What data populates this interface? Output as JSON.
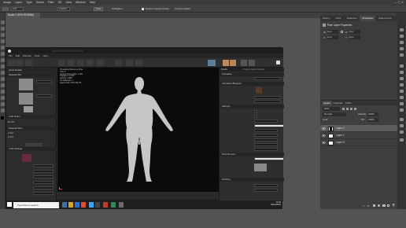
{
  "photoshop": {
    "menu": [
      "Image",
      "Layer",
      "Type",
      "Select",
      "Filter",
      "3D",
      "View",
      "Window",
      "Help"
    ],
    "options": {
      "antialias_label": "Anti",
      "value_label": "Feather",
      "style_label": "Normal",
      "select_mask_button": "Select and Mask...",
      "refine_label": "Refine Edge...",
      "clear_button": "Clear",
      "straighten_label": "Straighten",
      "delete_cropped_label": "Delete Cropped Pixels",
      "content_aware_label": "Content-Aware"
    },
    "document_tab": "Scale 1 50% RGB/8#)",
    "panel_tabs": [
      "History",
      "Color",
      "Swatches",
      "Properties",
      "Adjustments",
      "Libraries"
    ],
    "active_panel_tab": "Properties",
    "properties": {
      "title": "Pixel Layer Properties",
      "w_label": "W:",
      "w_value": "0 px",
      "h_label": "H:",
      "h_value": "0 px",
      "x_label": "X:",
      "x_value": "0 px",
      "y_label": "Y:",
      "y_value": "0 px"
    },
    "layers_panel": {
      "tabs": [
        "Layers",
        "Channels",
        "Paths"
      ],
      "kind_label": "Kind",
      "blend_mode": "Normal",
      "opacity_label": "Opacity:",
      "opacity_value": "100%",
      "lock_label": "Lock:",
      "fill_label": "Fill:",
      "fill_value": "100%",
      "layers": [
        {
          "name": "Layer 2",
          "selected": true
        },
        {
          "name": "Layer 1",
          "selected": false
        },
        {
          "name": "Layer 0",
          "selected": false
        }
      ]
    }
  },
  "unreal": {
    "title": "Unreal Editor",
    "menu": [
      "File",
      "Edit",
      "Window",
      "Tools",
      "Help"
    ],
    "left_panel": {
      "header": "Asset Details",
      "sections": [
        "Material Slot",
        "LOD Picker",
        "Material Slots",
        "LOD Settings"
      ]
    },
    "viewport": {
      "stats": [
        "Previewing Reference Pose",
        "LOD: 0",
        "Current Screen Size: 1.165",
        "Triangles: 14,784",
        "Vertices: 8,920",
        "UV Channels: 1",
        "Approx Size: 57x179x175"
      ]
    },
    "right_panel": {
      "tabs": [
        "Details",
        "Preview Scene Settings"
      ],
      "sections": [
        "Animation",
        "Animation Blueprint",
        "Settings",
        "Post Process",
        "Clothing"
      ]
    }
  },
  "taskbar": {
    "search_placeholder": "Type here to search",
    "time": "14:32",
    "date": "02/04/2020"
  },
  "accent": "#3d7fd3"
}
